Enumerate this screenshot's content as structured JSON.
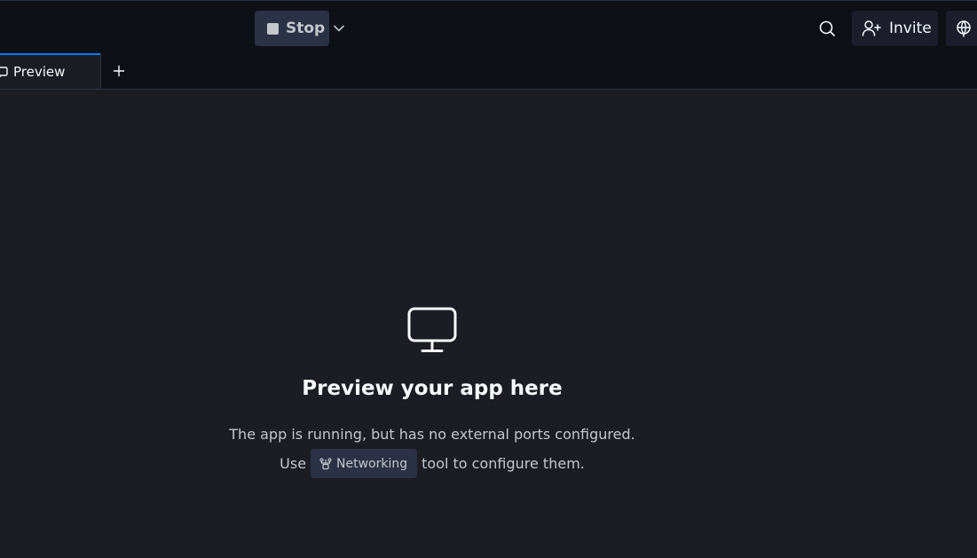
{
  "toolbar": {
    "stop_label": "Stop",
    "invite_label": "Invite"
  },
  "tabs": [
    {
      "label": "Preview",
      "active": true
    }
  ],
  "empty_state": {
    "title": "Preview your app here",
    "line1": "The app is running, but has no external ports configured.",
    "line2_prefix": "Use",
    "tool_label": "Networking",
    "line2_suffix": "tool to configure them."
  },
  "icons": {
    "stop": "stop-square-icon",
    "dropdown": "chevron-down-icon",
    "search": "search-icon",
    "invite": "user-plus-icon",
    "deploy": "globe-icon",
    "preview_tab": "monitor-icon",
    "new_tab": "plus-icon",
    "empty_state": "monitor-icon",
    "networking": "network-icon"
  },
  "colors": {
    "accent": "#0079f2",
    "background": "#1c1d24",
    "topbar": "#0e1017"
  }
}
